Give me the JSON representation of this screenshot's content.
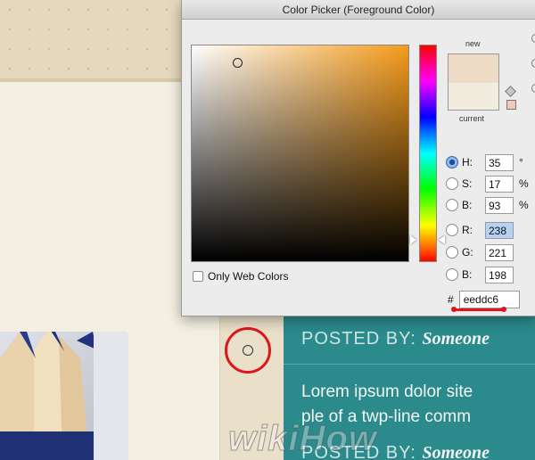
{
  "dialog": {
    "title": "Color Picker (Foreground Color)",
    "only_web_colors_label": "Only Web Colors",
    "new_label": "new",
    "current_label": "current",
    "hue_color": "#f59b1b",
    "new_color": "#eedcc6",
    "current_color": "#f2ecdf",
    "fields": [
      {
        "label": "H:",
        "value": "35",
        "unit": "°",
        "selected": true
      },
      {
        "label": "S:",
        "value": "17",
        "unit": "%",
        "selected": false
      },
      {
        "label": "B:",
        "value": "93",
        "unit": "%",
        "selected": false
      },
      {
        "label": "R:",
        "value": "238",
        "unit": "",
        "selected": false
      },
      {
        "label": "G:",
        "value": "221",
        "unit": "",
        "selected": false
      },
      {
        "label": "B:",
        "value": "198",
        "unit": "",
        "selected": false
      }
    ],
    "hex_prefix": "#",
    "hex_value": "eeddc6"
  },
  "page": {
    "posted_by_label": "POSTED BY:",
    "posted_by_name": "Someone",
    "lorem_line1": "Lorem ipsum dolor site",
    "lorem_line2": "ple of a twp-line comm",
    "watermark": "wikiHow"
  },
  "highlight_color": "#e0141b"
}
